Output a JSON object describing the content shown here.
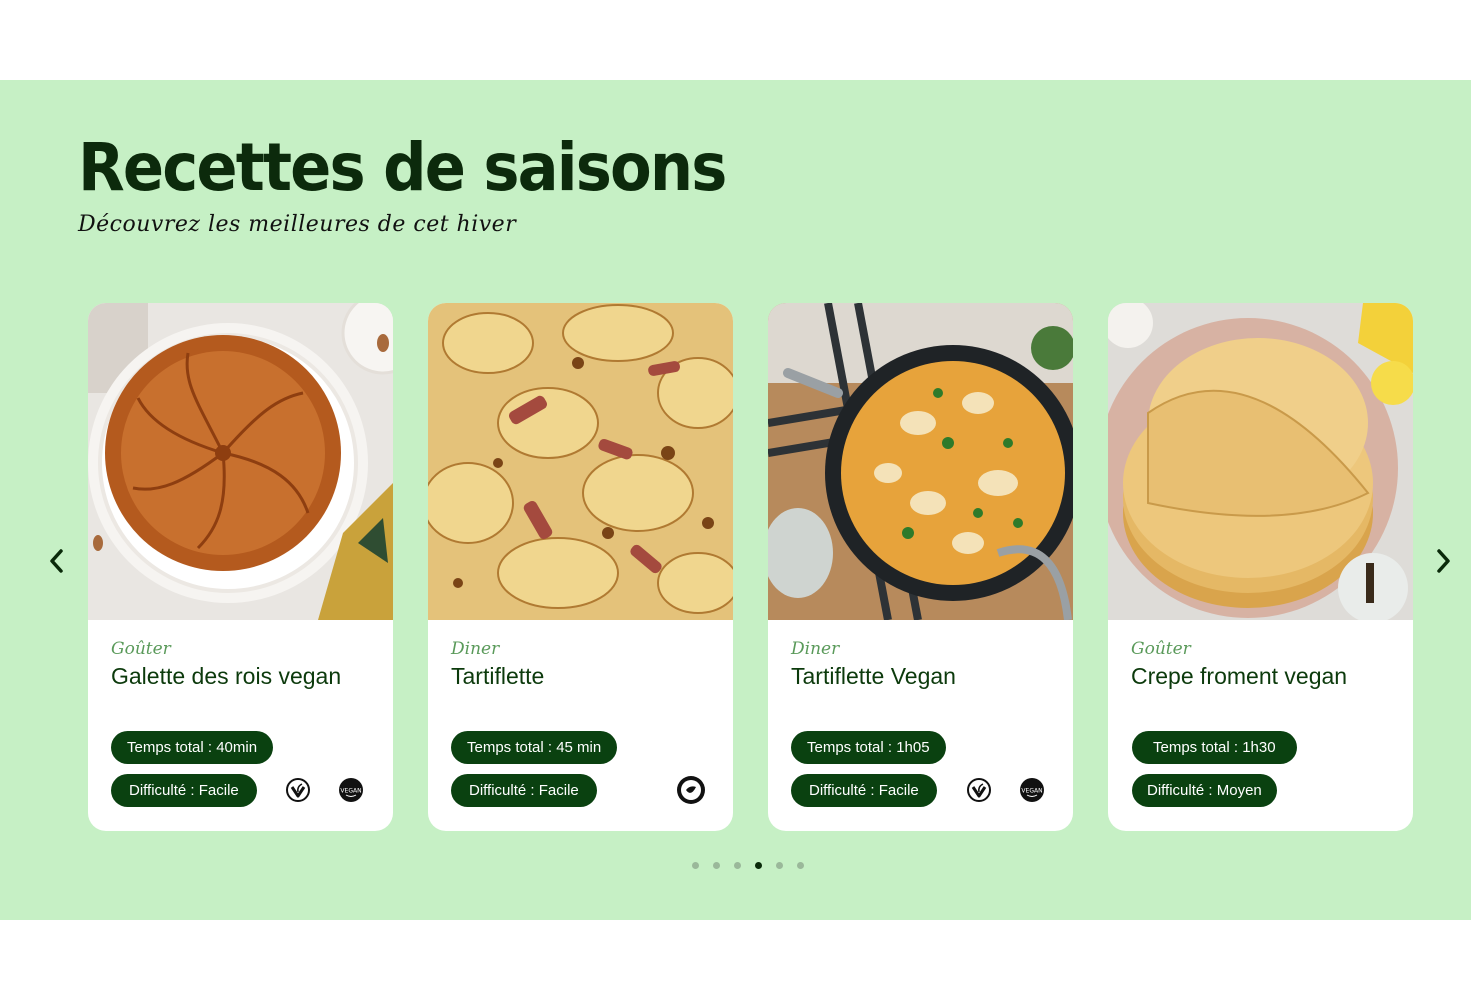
{
  "section": {
    "title": "Recettes de saisons",
    "subtitle": "Découvrez les meilleures de cet hiver",
    "background_color": "#c6f0c5",
    "accent_color": "#0a4110"
  },
  "navigation": {
    "prev_icon": "chevron-left-icon",
    "next_icon": "chevron-right-icon"
  },
  "cards": [
    {
      "category": "Goûter",
      "title": "Galette des rois vegan",
      "time": "Temps total : 40min",
      "difficulty": "Difficulté : Facile",
      "image": "galette-des-rois-photo",
      "badges": [
        "vegetarian-icon",
        "vegan-icon"
      ]
    },
    {
      "category": "Diner",
      "title": "Tartiflette",
      "time": "Temps total : 45 min",
      "difficulty": "Difficulté : Facile",
      "image": "tartiflette-photo",
      "badges": [
        "vegetarian-label-icon"
      ]
    },
    {
      "category": "Diner",
      "title": "Tartiflette Vegan",
      "time": "Temps total : 1h05",
      "difficulty": "Difficulté : Facile",
      "image": "tartiflette-vegan-photo",
      "badges": [
        "vegetarian-icon",
        "vegan-icon"
      ]
    },
    {
      "category": "Goûter",
      "title": "Crepe froment vegan",
      "time": "Temps total : 1h30",
      "difficulty": "Difficulté : Moyen",
      "image": "crepes-photo",
      "badges": []
    }
  ],
  "pagination": {
    "count": 6,
    "active_index": 3
  },
  "badge_labels": {
    "vegan": "VEGAN"
  }
}
